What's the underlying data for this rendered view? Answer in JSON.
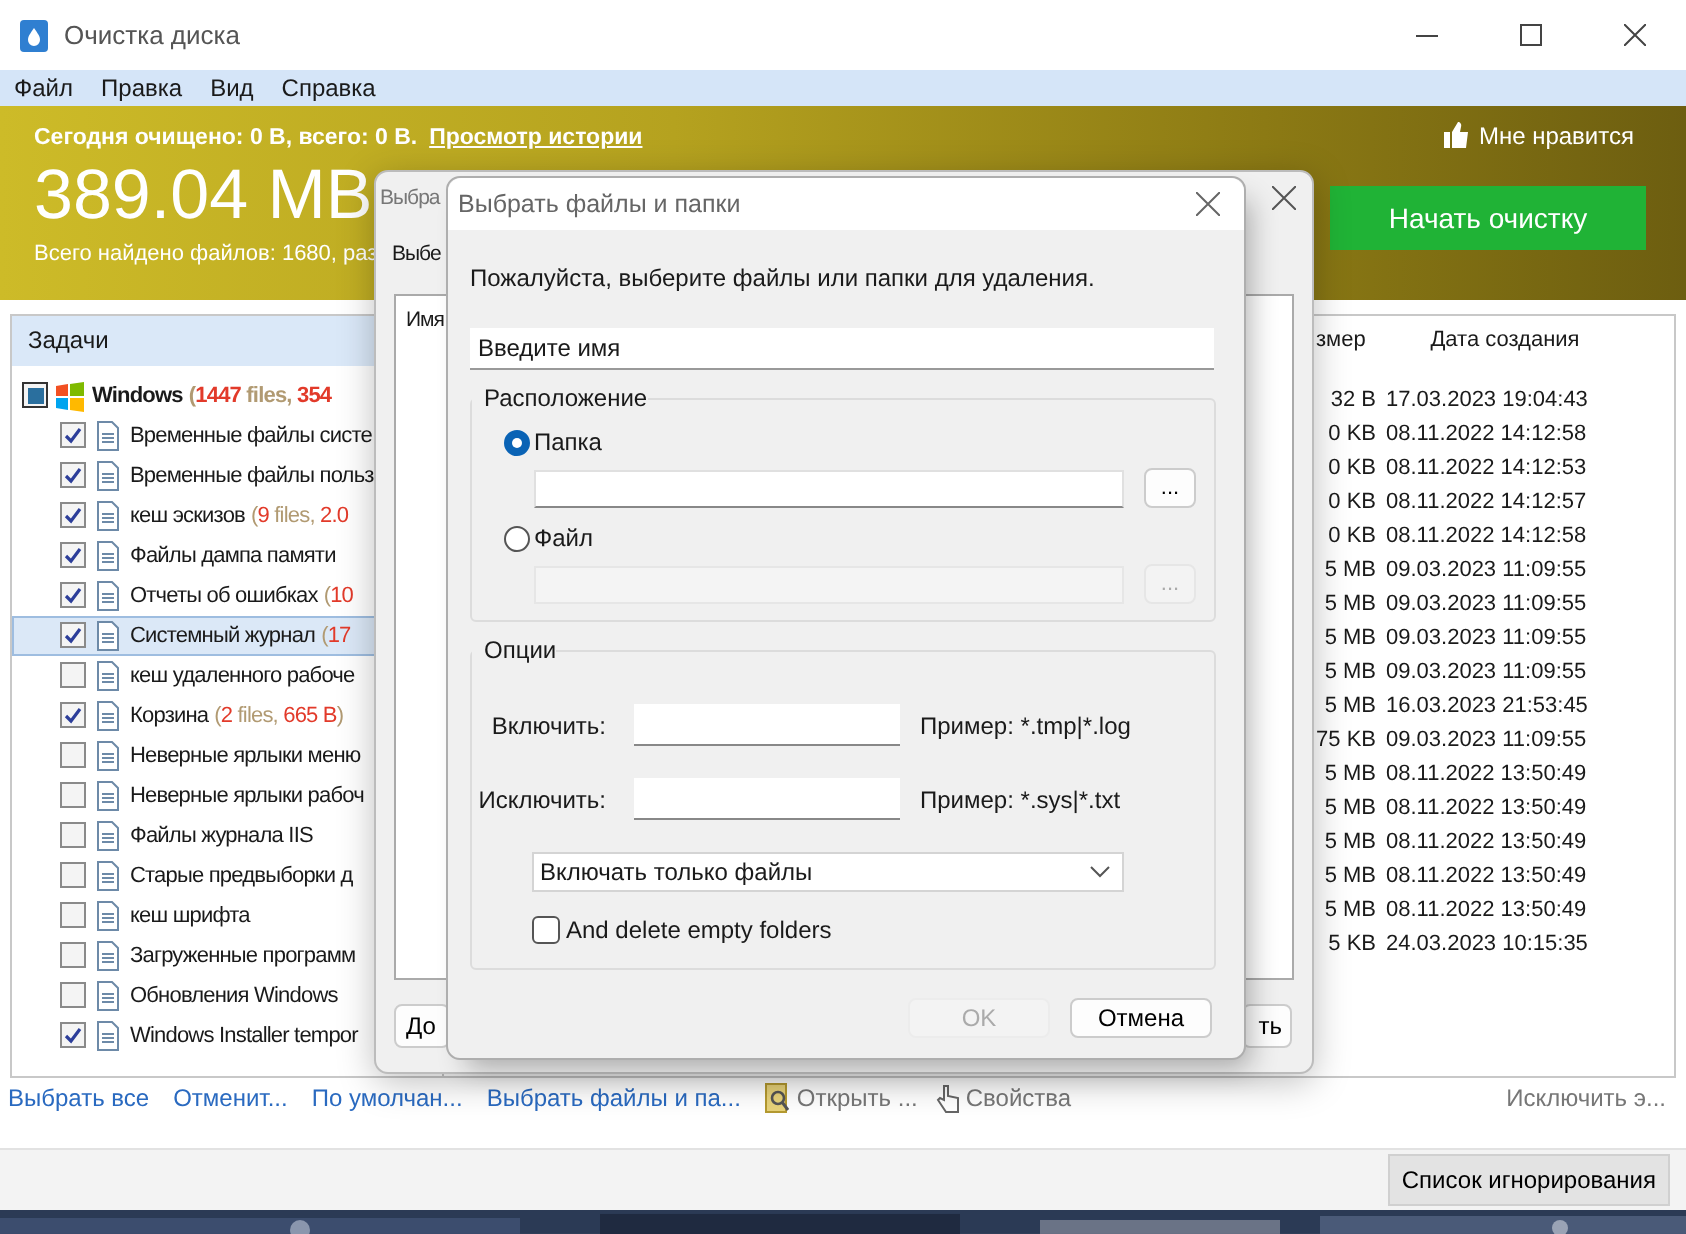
{
  "window": {
    "title": "Очистка диска"
  },
  "menu": [
    "Файл",
    "Правка",
    "Вид",
    "Справка"
  ],
  "banner": {
    "summary": "Сегодня очищено: 0 B, всего: 0 B.",
    "history_link": "Просмотр истории",
    "total": "389.04 MB",
    "found": "Всего найдено файлов: 1680, раз",
    "like": "Мне нравится",
    "start_button": "Начать очистку"
  },
  "tasks": {
    "header": "Задачи",
    "tree": [
      {
        "label": "Windows",
        "partial": true,
        "selected": false,
        "stats": [
          {
            "text": "(",
            "red": false
          },
          {
            "text": "1447",
            "red": true
          },
          {
            "text": " files, ",
            "red": false
          },
          {
            "text": "354",
            "red": true
          }
        ],
        "children": [
          {
            "label": "Временные файлы систе",
            "checked": true,
            "selected": false
          },
          {
            "label": "Временные файлы польз",
            "checked": true,
            "selected": false
          },
          {
            "label": "кеш эскизов",
            "checked": true,
            "selected": false,
            "stats": [
              {
                "text": "(",
                "red": false
              },
              {
                "text": "9",
                "red": true
              },
              {
                "text": " files, ",
                "red": false
              },
              {
                "text": "2.0",
                "red": true
              }
            ]
          },
          {
            "label": "Файлы дампа памяти",
            "checked": true,
            "selected": false
          },
          {
            "label": "Отчеты об ошибках",
            "checked": true,
            "selected": false,
            "stats": [
              {
                "text": "(",
                "red": false
              },
              {
                "text": "10",
                "red": true
              }
            ]
          },
          {
            "label": "Системный журнал",
            "checked": true,
            "selected": true,
            "stats": [
              {
                "text": "(",
                "red": false
              },
              {
                "text": "17",
                "red": true
              }
            ]
          },
          {
            "label": "кеш удаленного рабоче",
            "checked": false,
            "selected": false
          },
          {
            "label": "Корзина",
            "checked": true,
            "selected": false,
            "stats": [
              {
                "text": "(",
                "red": false
              },
              {
                "text": "2",
                "red": true
              },
              {
                "text": " files, ",
                "red": false
              },
              {
                "text": "665 B",
                "red": true
              },
              {
                "text": ")",
                "red": false
              }
            ]
          },
          {
            "label": "Неверные ярлыки меню",
            "checked": false,
            "selected": false
          },
          {
            "label": "Неверные ярлыки рабоч",
            "checked": false,
            "selected": false
          },
          {
            "label": "Файлы журнала IIS",
            "checked": false,
            "selected": false
          },
          {
            "label": "Старые предвыборки д",
            "checked": false,
            "selected": false
          },
          {
            "label": "кеш шрифта",
            "checked": false,
            "selected": false
          },
          {
            "label": "Загруженные программ",
            "checked": false,
            "selected": false
          },
          {
            "label": "Обновления Windows",
            "checked": false,
            "selected": false
          },
          {
            "label": "Windows Installer tempor",
            "checked": true,
            "selected": false
          }
        ]
      }
    ]
  },
  "file_list": {
    "columns": [
      "змер",
      "Дата создания"
    ],
    "rows": [
      {
        "size": "32 B",
        "created": "17.03.2023 19:04:43"
      },
      {
        "size": "0 KB",
        "created": "08.11.2022 14:12:58"
      },
      {
        "size": "0 KB",
        "created": "08.11.2022 14:12:53"
      },
      {
        "size": "0 KB",
        "created": "08.11.2022 14:12:57"
      },
      {
        "size": "0 KB",
        "created": "08.11.2022 14:12:58"
      },
      {
        "size": "5 MB",
        "created": "09.03.2023 11:09:55"
      },
      {
        "size": "5 MB",
        "created": "09.03.2023 11:09:55"
      },
      {
        "size": "5 MB",
        "created": "09.03.2023 11:09:55"
      },
      {
        "size": "5 MB",
        "created": "09.03.2023 11:09:55"
      },
      {
        "size": "5 MB",
        "created": "16.03.2023 21:53:45"
      },
      {
        "size": "75 KB",
        "created": "09.03.2023 11:09:55"
      },
      {
        "size": "5 MB",
        "created": "08.11.2022 13:50:49"
      },
      {
        "size": "5 MB",
        "created": "08.11.2022 13:50:49"
      },
      {
        "size": "5 MB",
        "created": "08.11.2022 13:50:49"
      },
      {
        "size": "5 MB",
        "created": "08.11.2022 13:50:49"
      },
      {
        "size": "5 MB",
        "created": "08.11.2022 13:50:49"
      },
      {
        "size": "5 KB",
        "created": "24.03.2023 10:15:35"
      }
    ]
  },
  "links": [
    {
      "label": "Выбрать все",
      "kind": "link"
    },
    {
      "label": "Отменит...",
      "kind": "link"
    },
    {
      "label": "По умолчан...",
      "kind": "link"
    },
    {
      "label": "Выбрать файлы и па...",
      "kind": "link"
    },
    {
      "label": "Открыть ...",
      "kind": "open"
    },
    {
      "label": "Свойства",
      "kind": "properties"
    },
    {
      "label": "Исключить э...",
      "kind": "end"
    }
  ],
  "footer_button": "Список игнорирования",
  "back_dialog": {
    "title": "Выбра",
    "label": "Выбе",
    "list_header": "Имя",
    "buttons": [
      "До",
      "ть"
    ]
  },
  "dialog": {
    "title": "Выбрать файлы и папки",
    "prompt": "Пожалуйста, выберите файлы или папки для удаления.",
    "name_field": {
      "placeholder": "Введите имя"
    },
    "location": {
      "title": "Расположение",
      "options": [
        {
          "label": "Папка",
          "selected": true,
          "browse": "..."
        },
        {
          "label": "Файл",
          "selected": false,
          "browse": "..."
        }
      ]
    },
    "options": {
      "title": "Опции",
      "filters": [
        {
          "label": "Включить:",
          "example": "Пример: *.tmp|*.log"
        },
        {
          "label": "Исключить:",
          "example": "Пример: *.sys|*.txt"
        }
      ],
      "mode": "Включать только файлы",
      "delete_empty": {
        "label": "And delete empty folders",
        "checked": false
      }
    },
    "buttons": [
      {
        "label": "OK",
        "disabled": true
      },
      {
        "label": "Отмена",
        "disabled": false
      }
    ]
  }
}
